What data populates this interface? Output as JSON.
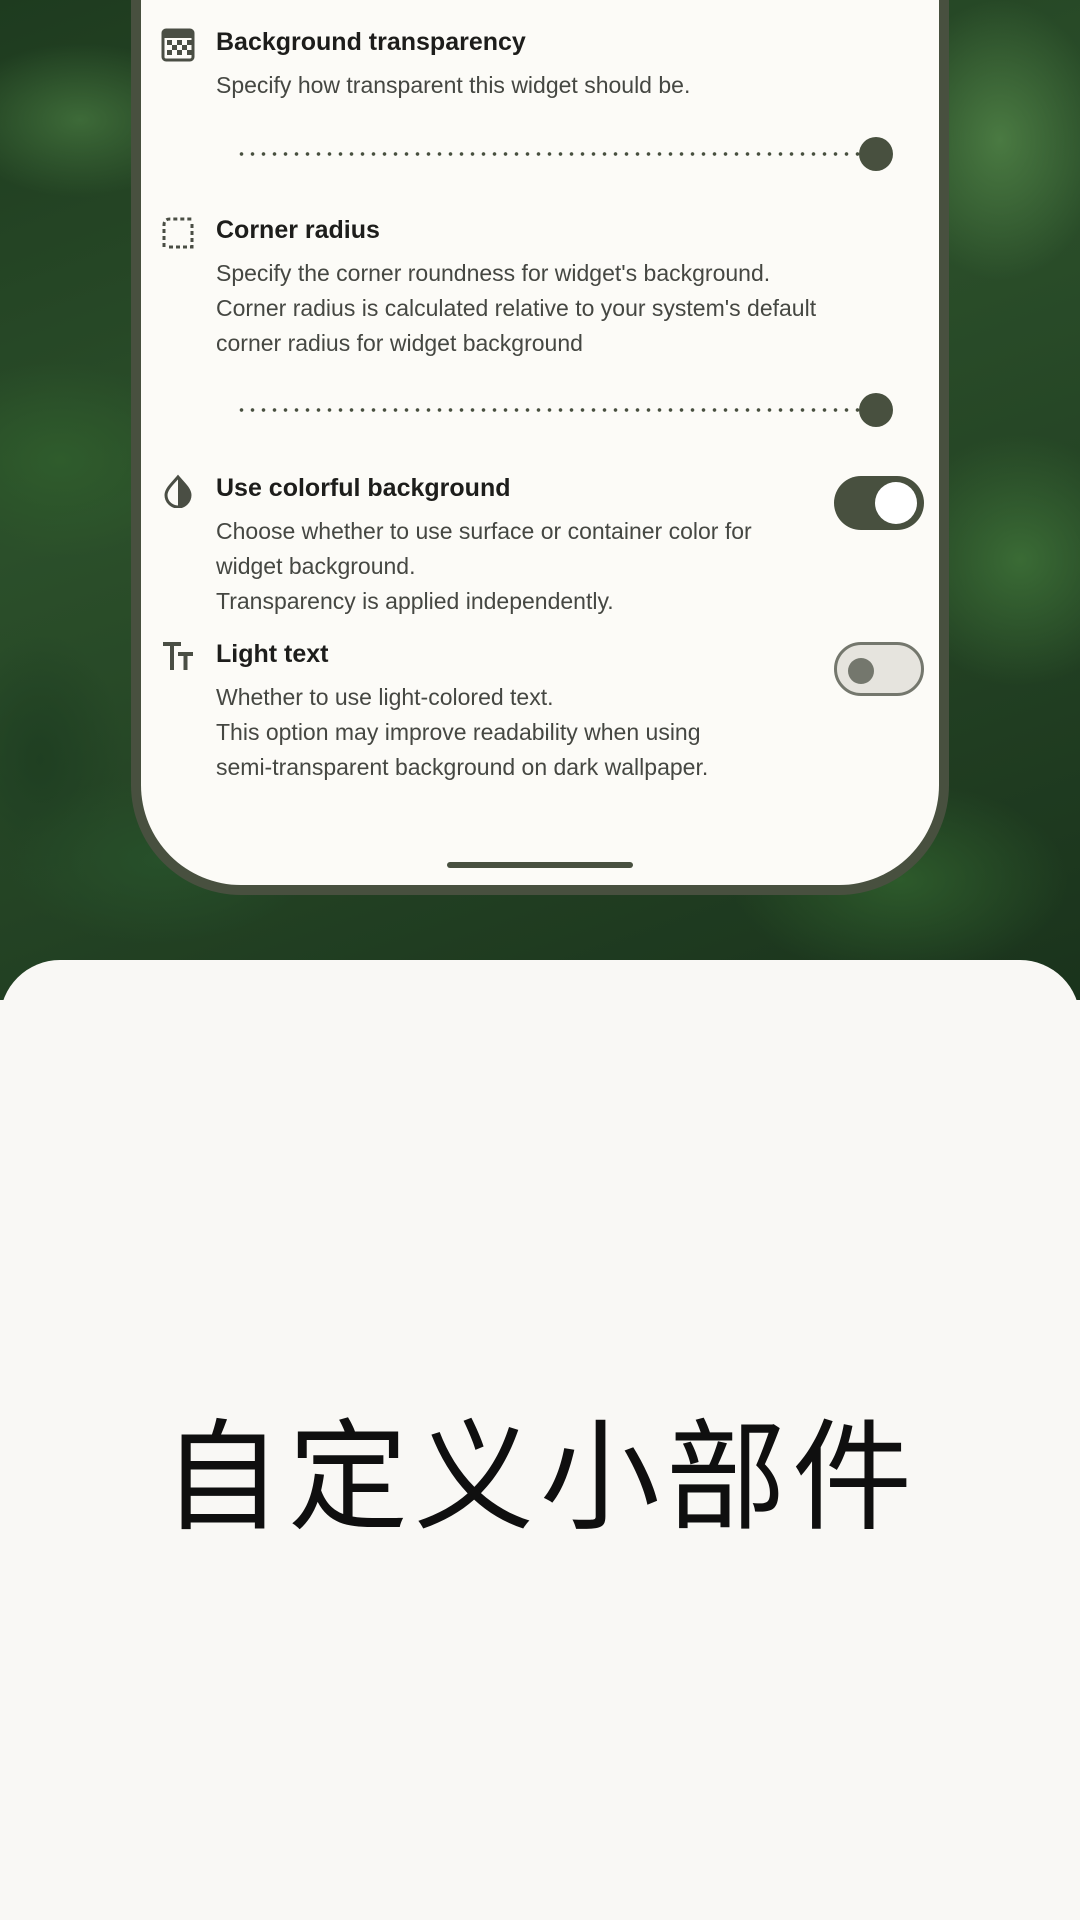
{
  "settings": {
    "background_transparency": {
      "title": "Background transparency",
      "description": "Specify how transparent this widget should be.",
      "icon": "transparency-grid-icon",
      "slider_value": 1.0
    },
    "corner_radius": {
      "title": "Corner radius",
      "description": "Specify the corner roundness for widget's background.\nCorner radius is calculated relative to your system's default\ncorner radius for widget background",
      "icon": "corner-radius-icon",
      "slider_value": 1.0
    },
    "colorful_background": {
      "title": "Use colorful background",
      "description": "Choose whether to use surface or container color for\nwidget background.\nTransparency is applied independently.",
      "icon": "contrast-drop-icon",
      "enabled": true
    },
    "light_text": {
      "title": "Light text",
      "description": "Whether to use light-colored text.\nThis option may improve readability when using\nsemi-transparent background on dark wallpaper.",
      "icon": "text-size-icon",
      "enabled": false
    }
  },
  "caption": "自定义小部件",
  "colors": {
    "accent": "#48503f",
    "surface": "#fcfbf7",
    "page_background": "#f9f8f5"
  }
}
